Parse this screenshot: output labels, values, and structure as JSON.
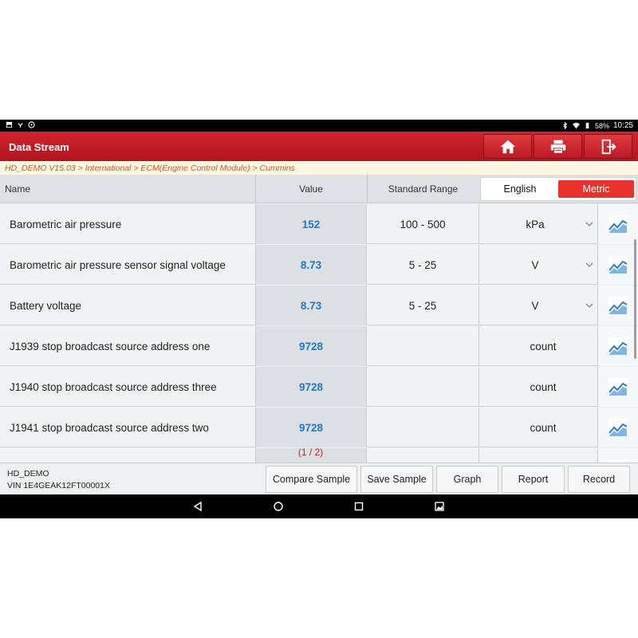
{
  "status_bar": {
    "battery": "58%",
    "time": "10:25"
  },
  "header": {
    "title": "Data Stream",
    "buttons": [
      "home-icon",
      "print-icon",
      "exit-icon"
    ]
  },
  "breadcrumb": "HD_DEMO V15.03 > International > ECM(Engine Control Module) > Cummins",
  "table": {
    "headers": {
      "name": "Name",
      "value": "Value",
      "range": "Standard Range"
    },
    "unit_toggle": {
      "english": "English",
      "metric": "Metric",
      "selected": "Metric"
    },
    "rows": [
      {
        "name": "Barometric air pressure",
        "value": "152",
        "range": "100 - 500",
        "unit": "kPa",
        "dropdown": true
      },
      {
        "name": "Barometric air pressure sensor signal voltage",
        "value": "8.73",
        "range": "5 - 25",
        "unit": "V",
        "dropdown": true
      },
      {
        "name": "Battery voltage",
        "value": "8.73",
        "range": "5 - 25",
        "unit": "V",
        "dropdown": true
      },
      {
        "name": "J1939 stop broadcast source address one",
        "value": "9728",
        "range": "",
        "unit": "count",
        "dropdown": false
      },
      {
        "name": "J1940 stop broadcast source address three",
        "value": "9728",
        "range": "",
        "unit": "count",
        "dropdown": false
      },
      {
        "name": "J1941 stop broadcast source address two",
        "value": "9728",
        "range": "",
        "unit": "count",
        "dropdown": false
      }
    ],
    "pager": "(1 / 2)"
  },
  "footer": {
    "vehicle": "HD_DEMO",
    "vin": "VIN 1E4GEAK12FT00001X",
    "buttons": {
      "compare_sample": "Compare Sample",
      "save_sample": "Save Sample",
      "graph": "Graph",
      "report": "Report",
      "record": "Record"
    }
  },
  "colors": {
    "brand_red": "#c41c27",
    "value_blue": "#1f77d0",
    "metric_red": "#e8322b",
    "breadcrumb_orange": "#d9541c"
  }
}
